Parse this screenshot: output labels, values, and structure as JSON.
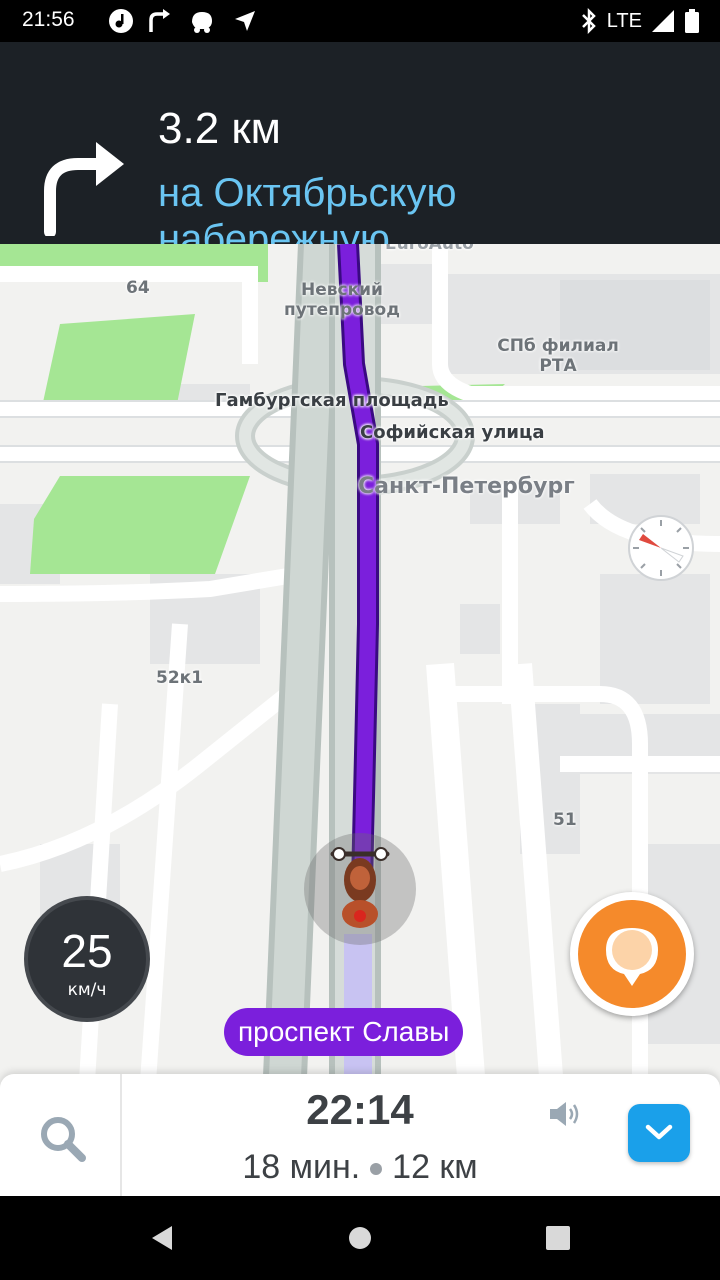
{
  "status_bar": {
    "time": "21:56",
    "network": "LTE"
  },
  "navigation": {
    "distance": "3.2 км",
    "street": "на Октябрьскую набережную",
    "maneuver_icon": "turn-right-icon"
  },
  "map": {
    "labels": {
      "truncated_top": "EuroAuto",
      "building_64": "64",
      "nevsky": "Невский путепровод",
      "spb_filial": "СПб филиал РТА",
      "hamburg_square": "Гамбургская площадь",
      "sofiyskaya": "Софийская улица",
      "city": "Санкт-Петербург",
      "building_52k1": "52к1",
      "building_51": "51"
    },
    "current_street": "проспект Славы",
    "route_color": "#7b1fdc"
  },
  "speedometer": {
    "value": "25",
    "unit": "км/ч"
  },
  "bottom_panel": {
    "eta": "22:14",
    "duration": "18 мин.",
    "distance": "12 км"
  },
  "colors": {
    "accent": "#6ac5f2",
    "report": "#f58a2b",
    "expand": "#1aa0ea"
  }
}
